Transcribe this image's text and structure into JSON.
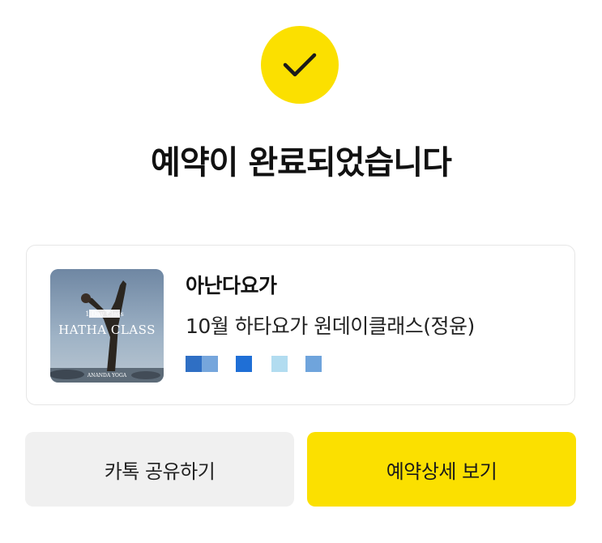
{
  "confirmation": {
    "icon": "check-icon",
    "badge_color": "#fbe000",
    "title": "예약이 완료되었습니다"
  },
  "reservation": {
    "shop_name": "아난다요가",
    "class_name": "10월 하타요가 원데이클래스(정윤)",
    "thumbnail": {
      "badge": "1 Day Class",
      "headline": "HATHA CLASS",
      "brand": "ANANDA YOGA"
    },
    "detail_block_colors": [
      "#2f6fc4",
      "#76a6dc",
      "#1f6fd6",
      "#b2dcf0",
      "#6fa4dc"
    ]
  },
  "actions": {
    "share_label": "카톡 공유하기",
    "detail_label": "예약상세 보기",
    "share_color": "#f0f0f0",
    "detail_color": "#fbe000"
  }
}
